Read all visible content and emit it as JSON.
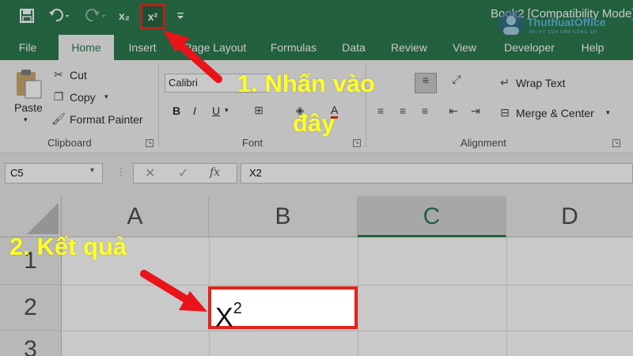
{
  "qat": {
    "save_icon": "save-icon",
    "undo_icon": "undo-icon",
    "redo_icon": "redo-icon",
    "subscript_label": "x₂",
    "superscript_label": "x²",
    "customize_icon": "customize-qat-icon"
  },
  "window_title": "Book2 [Compatibility Mode]",
  "logo": {
    "text": "ThuthuatOffice",
    "subtext": "TRI KỲ CỦA DÂN CÔNG SỞ"
  },
  "tabs": [
    "File",
    "Home",
    "Insert",
    "Page Layout",
    "Formulas",
    "Data",
    "Review",
    "View",
    "Developer",
    "Help"
  ],
  "ribbon": {
    "clipboard": {
      "paste": "Paste",
      "cut": "Cut",
      "copy": "Copy",
      "format_painter": "Format Painter",
      "label": "Clipboard"
    },
    "font": {
      "name": "Calibri",
      "label": "Font",
      "bold": "B",
      "italic": "I",
      "underline": "U",
      "font_color": "A"
    },
    "alignment": {
      "wrap_text": "Wrap Text",
      "merge_center": "Merge & Center",
      "label": "Alignment"
    }
  },
  "formula_bar": {
    "name_box": "C5",
    "formula": "X2",
    "fx_label": "fx"
  },
  "grid": {
    "columns": [
      "A",
      "B",
      "C",
      "D"
    ],
    "selected_column": "C",
    "rows": [
      "1",
      "2",
      "3"
    ],
    "cell_b2": {
      "base": "X",
      "superscript": "2"
    }
  },
  "annotations": {
    "step1_line1": "1. Nhấn vào",
    "step1_line2": "đây",
    "step2": "2. Kết quả"
  },
  "colors": {
    "excel_green": "#217346",
    "highlight_red": "#e2231a",
    "note_yellow": "#ffff22"
  }
}
